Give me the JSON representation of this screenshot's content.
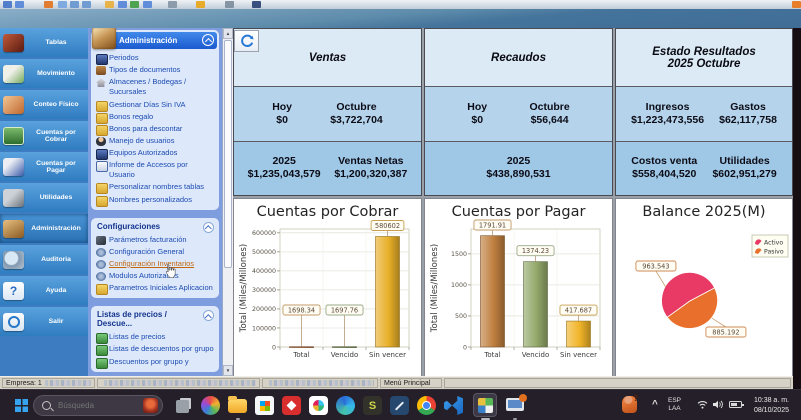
{
  "icons": {
    "refresh-icon": "blue circular arrows",
    "collapse-icon": "chevron-up in white circle",
    "search-icon": "magnifier",
    "windows-start-icon": "four blue squares",
    "hand-cursor-icon": "pointing hand",
    "wifi-icon": "signal arcs",
    "volume-icon": "speaker with waves",
    "battery-icon": "battery half",
    "scroll-up-icon": "triangle up",
    "scroll-down-icon": "triangle down"
  },
  "sidebar": {
    "items": [
      {
        "label": "Tablas",
        "icon": "book-icon"
      },
      {
        "label": "Movimiento",
        "icon": "cards-icon"
      },
      {
        "label": "Conteo Físico",
        "icon": "hand-icon"
      },
      {
        "label": "Cuentas por Cobrar",
        "icon": "money-icon"
      },
      {
        "label": "Cuentas por Pagar",
        "icon": "pen-icon"
      },
      {
        "label": "Utilidades",
        "icon": "tools-icon"
      },
      {
        "label": "Administración",
        "icon": "box-icon",
        "active": true
      },
      {
        "label": "Auditoria",
        "icon": "magnifier-icon"
      },
      {
        "label": "Ayuda",
        "icon": "question-icon"
      },
      {
        "label": "Salir",
        "icon": "power-icon"
      }
    ]
  },
  "menu": {
    "groups": [
      {
        "title": "Administración",
        "items": [
          {
            "label": "Periodos",
            "icon": "monitor-icon"
          },
          {
            "label": "Tipos de documentos",
            "icon": "books-icon"
          },
          {
            "label": "Almacenes / Bodegas / Sucursales",
            "icon": "home-icon"
          },
          {
            "label": "Gestionar Días Sin IVA",
            "icon": "folder-icon"
          },
          {
            "label": "Bonos regalo",
            "icon": "folder-icon"
          },
          {
            "label": "Bonos para descontar",
            "icon": "folder-icon"
          },
          {
            "label": "Manejo de usuarios",
            "icon": "user-icon"
          },
          {
            "label": "Equipos Autorizados",
            "icon": "monitor-icon"
          },
          {
            "label": "Informe de Accesos por Usuario",
            "icon": "report-icon"
          },
          {
            "label": "Personalizar nombres tablas",
            "icon": "folder-icon"
          },
          {
            "label": "Nombres personalizados",
            "icon": "folder-icon"
          }
        ]
      },
      {
        "title": "Configuraciones",
        "items": [
          {
            "label": "Parámetros facturación",
            "icon": "wrench-icon"
          },
          {
            "label": "Configuración General",
            "icon": "gear-icon"
          },
          {
            "label": "Configuración Inventarios",
            "icon": "gear-icon",
            "highlighted": true
          },
          {
            "label": "Modulos Autorizados",
            "icon": "gear-icon"
          },
          {
            "label": "Parametros Iniciales Aplicacion",
            "icon": "folder-icon"
          }
        ]
      },
      {
        "title": "Listas de precios / Descue...",
        "items": [
          {
            "label": "Listas de precios",
            "icon": "cards-icon"
          },
          {
            "label": "Listas de descuentos por grupo",
            "icon": "cards-icon"
          },
          {
            "label": "Descuentos por grupo y",
            "icon": "cards-icon"
          }
        ]
      }
    ]
  },
  "stats": {
    "ventas": {
      "title": "Ventas",
      "hoy_label": "Hoy",
      "hoy": "$0",
      "mes_label": "Octubre",
      "mes": "$3,722,704",
      "anio_label": "2025",
      "anio": "$1,235,043,579",
      "netas_label": "Ventas Netas",
      "netas": "$1,200,320,387"
    },
    "recaudos": {
      "title": "Recaudos",
      "hoy_label": "Hoy",
      "hoy": "$0",
      "mes_label": "Octubre",
      "mes": "$56,644",
      "anio_label": "2025",
      "anio": "$438,890,531"
    },
    "estado": {
      "title_line1": "Estado Resultados",
      "title_line2": "2025 Octubre",
      "ingresos_label": "Ingresos",
      "ingresos": "$1,223,473,556",
      "gastos_label": "Gastos",
      "gastos": "$62,117,758",
      "costos_label": "Costos venta",
      "costos": "$558,404,520",
      "utilidades_label": "Utilidades",
      "utilidades": "$602,951,279"
    }
  },
  "chart_data": [
    {
      "type": "bar",
      "title": "Cuentas por Cobrar",
      "ylabel": "Total (Miles/Millones)",
      "categories": [
        "Total",
        "Vencido",
        "Sin vencer"
      ],
      "values": [
        1698.34,
        1697.76,
        580602
      ],
      "labels": [
        "1698.34",
        "1697.76",
        "580602"
      ],
      "bar_colors": [
        "#c08050",
        "#8aa068",
        "#e8af28"
      ],
      "label_border_colors": [
        "#c49a6a",
        "#9aaa88",
        "#c8a050"
      ],
      "ylim": [
        0,
        620000
      ],
      "yticks": [
        0,
        100000,
        200000,
        300000,
        400000,
        500000,
        600000
      ],
      "grid": true,
      "legend": null
    },
    {
      "type": "bar",
      "title": "Cuentas por Pagar",
      "ylabel": "Total (Miles/Millones)",
      "categories": [
        "Total",
        "Vencido",
        "Sin vencer"
      ],
      "values": [
        1791.91,
        1374.23,
        417.687
      ],
      "labels": [
        "1791.91",
        "1374.23",
        "417.687"
      ],
      "bar_colors": [
        "#bf7f3f",
        "#93a86a",
        "#f0b428"
      ],
      "label_border_colors": [
        "#c49a6a",
        "#9aaa88",
        "#c8a050"
      ],
      "ylim": [
        0,
        1900
      ],
      "yticks": [
        0,
        500,
        1000,
        1500
      ],
      "grid": true,
      "legend": null
    },
    {
      "type": "pie",
      "title": "Balance 2025(M)",
      "slices": [
        {
          "name": "Activo",
          "value": 963.543,
          "label": "963.543",
          "color": "#e83a64"
        },
        {
          "name": "Pasivo",
          "value": 885.192,
          "label": "885.192",
          "color": "#e8702c"
        }
      ],
      "legend_position": "top-right",
      "start_angle": 28
    }
  ],
  "statusbar": {
    "company": "Empresa: 1",
    "menu_label": "Menú Principal"
  },
  "taskbar": {
    "search_placeholder": "Búsqueda",
    "icons": [
      "task-view",
      "color-wheel",
      "file-explorer",
      "microsoft-store",
      "remote-app",
      "slack",
      "edge",
      "s-app",
      "dev-tool",
      "chrome",
      "vscode",
      "erp-app-active",
      "monitor-app"
    ],
    "tray": {
      "lang_top": "ESP",
      "lang_bottom": "LAA",
      "time": "10:38 a. m.",
      "date": "08/10/2025"
    }
  },
  "colors": {
    "sidebar_blue": "#2f7cc0",
    "menu_panel": "#7d9dde",
    "group_header_blue": "#1b5ad0",
    "stat_header": "#dceaf6",
    "stat_row1": "#b5d4ec",
    "stat_row2": "#9fc7e6",
    "taskbar": "#241f28",
    "activo_pink": "#e83a64",
    "pasivo_orange": "#e8702c",
    "highlight_orange": "#c2670f"
  }
}
